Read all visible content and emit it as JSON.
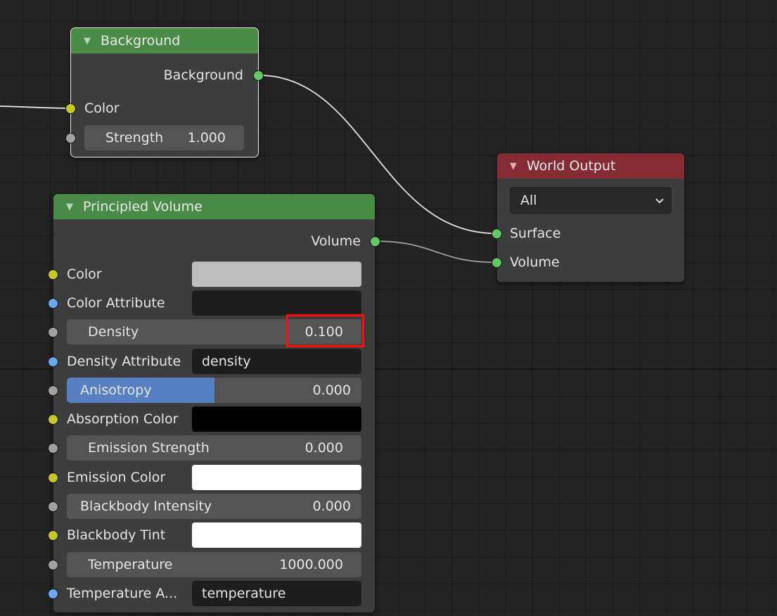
{
  "editor": "Shader Editor (World)",
  "nodes": {
    "background": {
      "title": "Background",
      "header_color": "#4a8b48",
      "selected": true,
      "output": "Background",
      "inputs": {
        "color_label": "Color",
        "strength_label": "Strength",
        "strength_value": "1.000"
      }
    },
    "world_output": {
      "title": "World Output",
      "header_color": "#842b33",
      "target_dropdown": "All",
      "inputs": [
        "Surface",
        "Volume"
      ]
    },
    "principled_volume": {
      "title": "Principled Volume",
      "header_color": "#4a8b48",
      "output": "Volume",
      "inputs": {
        "color": {
          "label": "Color",
          "swatch": "#bdbdbd"
        },
        "color_attribute": {
          "label": "Color Attribute",
          "value": ""
        },
        "density": {
          "label": "Density",
          "value": "0.100",
          "highlighted": true
        },
        "density_attribute": {
          "label": "Density Attribute",
          "value": "density"
        },
        "anisotropy": {
          "label": "Anisotropy",
          "value": "0.000",
          "fill_fraction": 0.5
        },
        "absorption_color": {
          "label": "Absorption Color",
          "swatch": "#000000"
        },
        "emission_strength": {
          "label": "Emission Strength",
          "value": "0.000"
        },
        "emission_color": {
          "label": "Emission Color",
          "swatch": "#ffffff"
        },
        "blackbody_intensity": {
          "label": "Blackbody Intensity",
          "value": "0.000"
        },
        "blackbody_tint": {
          "label": "Blackbody Tint",
          "swatch": "#ffffff"
        },
        "temperature": {
          "label": "Temperature",
          "value": "1000.000"
        },
        "temperature_attribute": {
          "label": "Temperature A...",
          "value": "temperature"
        }
      }
    }
  },
  "links": [
    {
      "from": "external",
      "to": "background.color"
    },
    {
      "from": "background.background",
      "to": "world_output.surface"
    },
    {
      "from": "principled_volume.volume",
      "to": "world_output.volume"
    }
  ],
  "socket_colors": {
    "shader": "#63c763",
    "color": "#c7c729",
    "float": "#a1a1a1",
    "string": "#6aa8f5"
  },
  "highlight_color": "#ff0d0d"
}
